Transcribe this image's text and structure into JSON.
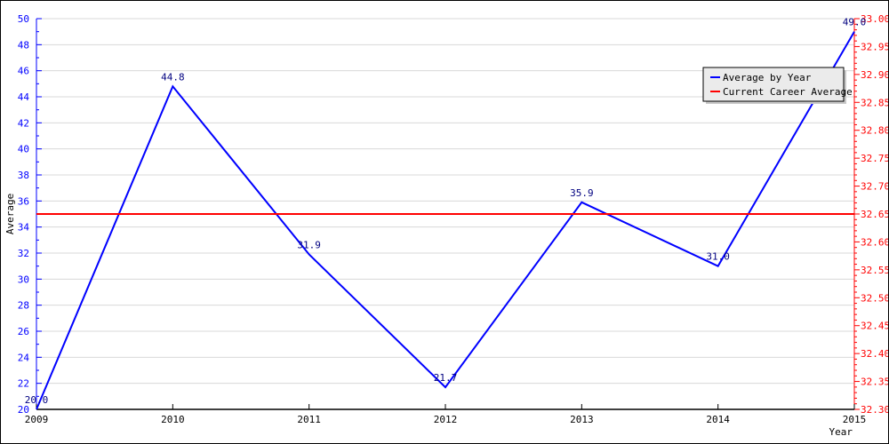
{
  "chart_data": {
    "type": "line",
    "title": "",
    "xlabel": "Year",
    "ylabel": "Average",
    "x": [
      2009,
      2010,
      2011,
      2012,
      2013,
      2014,
      2015
    ],
    "xlim": [
      2009,
      2015
    ],
    "ylim": [
      20,
      50
    ],
    "yticks": [
      20,
      22,
      24,
      26,
      28,
      30,
      32,
      34,
      36,
      38,
      40,
      42,
      44,
      46,
      48,
      50
    ],
    "y2lim": [
      32.3,
      33.0
    ],
    "y2ticks": [
      "32.30",
      "32.35",
      "32.40",
      "32.45",
      "32.50",
      "32.55",
      "32.60",
      "32.65",
      "32.70",
      "32.75",
      "32.80",
      "32.85",
      "32.90",
      "32.95",
      "33.00"
    ],
    "grid": true,
    "legend_position": "top-right",
    "series": [
      {
        "name": "Average by Year",
        "axis": "left",
        "color": "#0000ff",
        "values": [
          20.0,
          44.8,
          31.9,
          21.7,
          35.9,
          31.0,
          49.0
        ],
        "labels": [
          "20.0",
          "44.8",
          "31.9",
          "21.7",
          "35.9",
          "31.0",
          "49.0"
        ]
      },
      {
        "name": "Current Career Average",
        "axis": "right",
        "color": "#ff0000",
        "values": [
          32.65,
          32.65,
          32.65,
          32.65,
          32.65,
          32.65,
          32.65
        ]
      }
    ],
    "colors": {
      "left_axis": "#0000ff",
      "right_axis": "#ff0000",
      "label_text": "#000080",
      "grid": "#d8d8d8"
    }
  }
}
